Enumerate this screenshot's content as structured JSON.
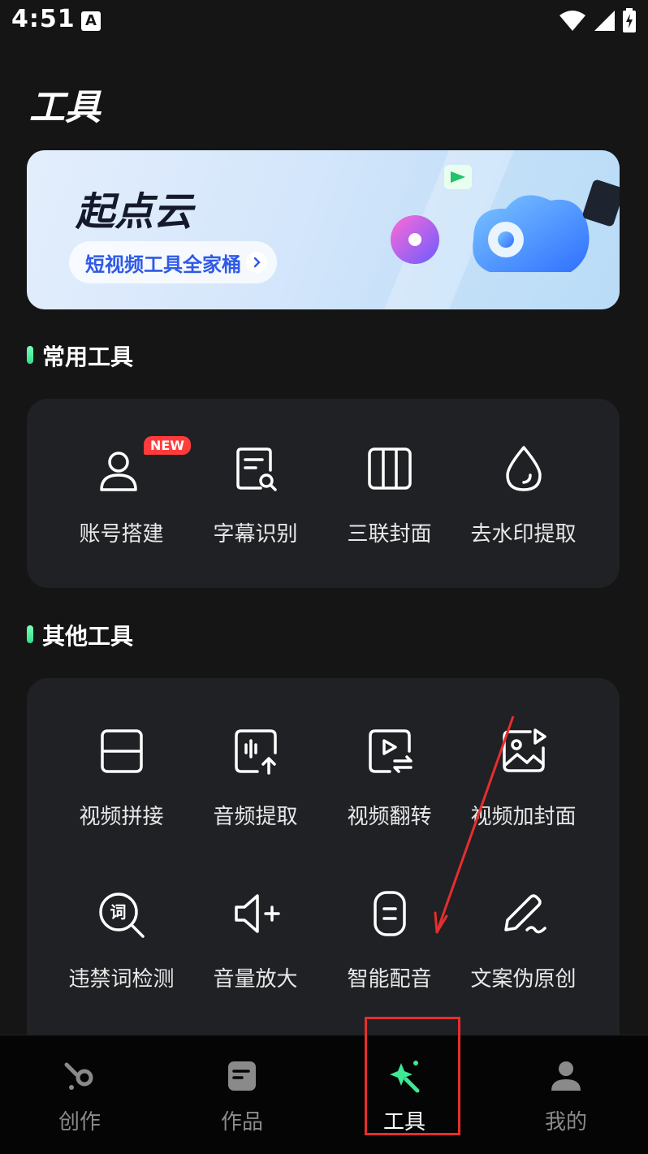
{
  "status_bar": {
    "time": "4:51",
    "notification": "A"
  },
  "page": {
    "title": "工具"
  },
  "banner": {
    "title": "起点云",
    "pill_label": "短视频工具全家桶"
  },
  "sections": {
    "common": {
      "title": "常用工具",
      "badge": "NEW",
      "tools": [
        {
          "label": "账号搭建",
          "icon": "person-icon"
        },
        {
          "label": "字幕识别",
          "icon": "document-search-icon"
        },
        {
          "label": "三联封面",
          "icon": "three-columns-icon"
        },
        {
          "label": "去水印提取",
          "icon": "water-drop-icon"
        }
      ]
    },
    "other": {
      "title": "其他工具",
      "icon_text": "词",
      "tools": [
        {
          "label": "视频拼接",
          "icon": "split-frame-icon"
        },
        {
          "label": "音频提取",
          "icon": "audio-upload-icon"
        },
        {
          "label": "视频翻转",
          "icon": "video-swap-icon"
        },
        {
          "label": "视频加封面",
          "icon": "image-icon"
        },
        {
          "label": "违禁词检测",
          "icon": "word-search-icon"
        },
        {
          "label": "音量放大",
          "icon": "speaker-plus-icon"
        },
        {
          "label": "智能配音",
          "icon": "voice-icon"
        },
        {
          "label": "文案伪原创",
          "icon": "pen-icon"
        }
      ]
    }
  },
  "bottom_nav": [
    {
      "label": "创作",
      "icon": "create-icon"
    },
    {
      "label": "作品",
      "icon": "works-icon"
    },
    {
      "label": "工具",
      "icon": "magic-wand-icon",
      "active": true
    },
    {
      "label": "我的",
      "icon": "profile-icon"
    }
  ],
  "colors": {
    "background": "#151516",
    "card": "#1f2124",
    "accent_green": "#3ee895",
    "annotation_red": "#e62e2e",
    "badge_red": "#ff3b3b",
    "pill_text_blue": "#2f59e8"
  }
}
